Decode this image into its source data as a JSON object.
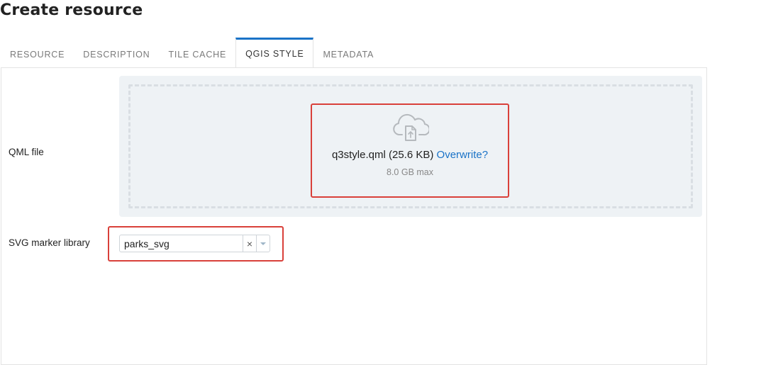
{
  "page": {
    "title": "Create resource"
  },
  "tabs": [
    {
      "label": "RESOURCE",
      "active": false
    },
    {
      "label": "DESCRIPTION",
      "active": false
    },
    {
      "label": "TILE CACHE",
      "active": false
    },
    {
      "label": "QGIS STYLE",
      "active": true
    },
    {
      "label": "METADATA",
      "active": false
    }
  ],
  "form": {
    "qml_label": "QML file",
    "upload": {
      "icon": "cloud-upload-icon",
      "file_name": "q3style.qml",
      "file_size": "(25.6 KB)",
      "overwrite_label": "Overwrite?",
      "max_size": "8.0 GB max"
    },
    "svg_label": "SVG marker library",
    "svg_select": {
      "value": "parks_svg",
      "clear_symbol": "×"
    }
  },
  "colors": {
    "accent": "#1a73c7",
    "highlight": "#d9403a",
    "dropzone_bg": "#eef2f5"
  }
}
